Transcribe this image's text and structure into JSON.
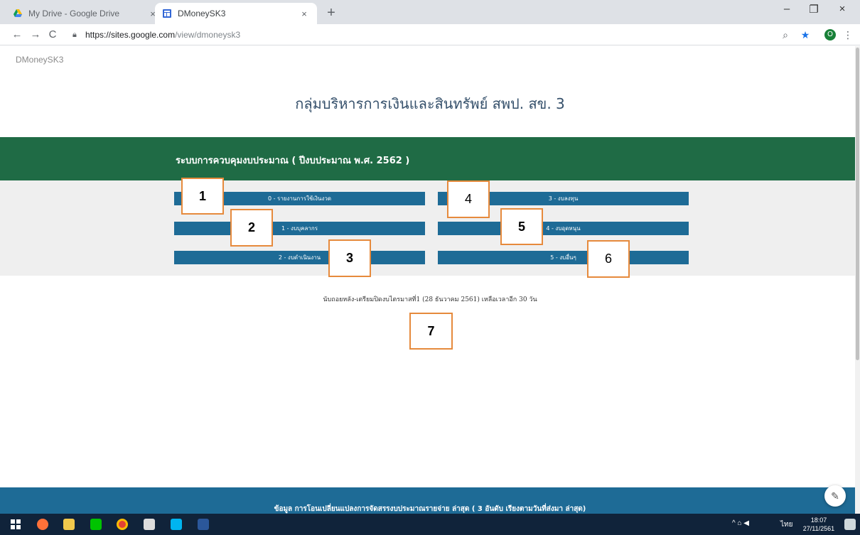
{
  "browser": {
    "tabs": [
      {
        "title": "My Drive - Google Drive",
        "close": "×"
      },
      {
        "title": "DMoneySK3",
        "close": "×"
      }
    ],
    "new_tab": "+",
    "window_controls": {
      "minimize": "–",
      "restore": "❐",
      "close": "×"
    },
    "url_host": "https://sites.google.com",
    "url_path": "/view/dmoneysk3",
    "nav": {
      "back": "←",
      "forward": "→",
      "reload": "C"
    },
    "profile_initial": "O"
  },
  "page": {
    "site_name": "DMoneySK3",
    "heading": "กลุ่มบริหารการเงินและสินทรัพย์ สพป. สข. 3",
    "budget_section_title": "ระบบการควบคุมงบประมาณ ( ปีงบประมาณ พ.ศ. 2562 )",
    "buttons": [
      "0 - รายงานการใช้เงินงวด",
      "1 - งบบุคลากร",
      "2 - งบดำเนินงาน",
      "3 - งบลงทุน",
      "4 - งบอุดหนุน",
      "5 - งบอื่นๆ"
    ],
    "countdown": "นับถอยหลัง-เตรียมปิดงบไตรมาสที่1 (28 ธันวาคม 2561) เหลือเวลาอีก 30 วัน",
    "footer_title": "ข้อมูล การโอนเปลี่ยนแปลงการจัดสรรงบประมาณรายจ่าย ล่าสุด ( 3 อันดับ เรียงตามวันที่ส่งมา ล่าสุด)",
    "edit_icon": "✎"
  },
  "annotations": [
    "1",
    "2",
    "3",
    "4",
    "5",
    "6",
    "7"
  ],
  "taskbar": {
    "tray": "^  ⌂  ◀",
    "lang": "ไทย",
    "time": "18:07",
    "date": "27/11/2561"
  },
  "colors": {
    "green_band": "#1f6b45",
    "button_blue": "#1e6b96",
    "annotation_border": "#e68a3c",
    "heading": "#35506b"
  }
}
